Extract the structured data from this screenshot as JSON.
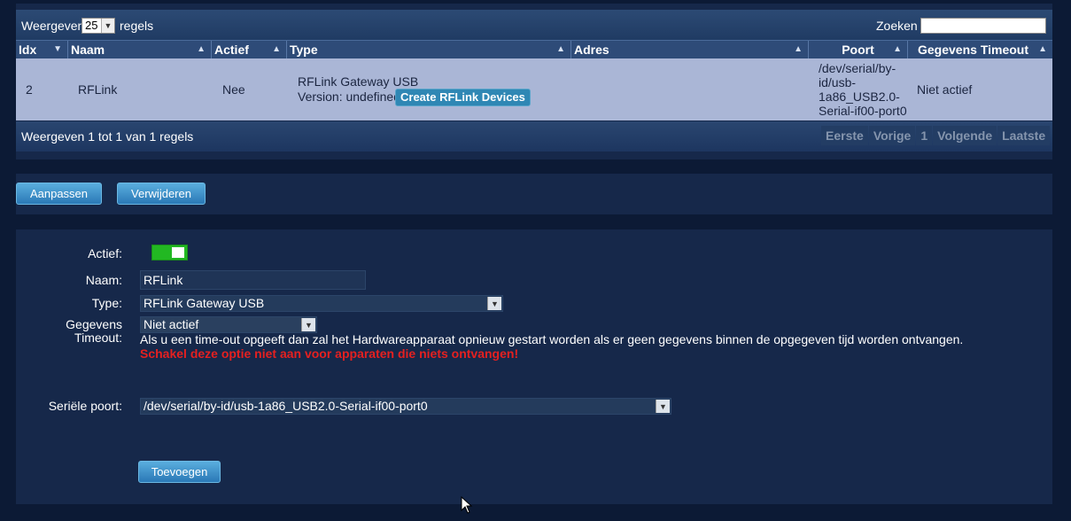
{
  "table": {
    "show_prefix": "Weergeven",
    "page_length": "25",
    "show_suffix": "regels",
    "search_label": "Zoeken :",
    "search_value": "",
    "columns": [
      "Idx",
      "Naam",
      "Actief",
      "Type",
      "Adres",
      "Poort",
      "Gegevens Timeout"
    ],
    "row": {
      "idx": "2",
      "naam": "RFLink",
      "actief": "Nee",
      "type_line1": "RFLink Gateway USB",
      "type_line2": "Version: undefined",
      "create_button": "Create RFLink Devices",
      "adres": "",
      "poort_lines": [
        "/dev/serial/by-",
        "id/usb-",
        "1a86_USB2.0-",
        "Serial-if00-port0"
      ],
      "timeout": "Niet actief"
    },
    "info": "Weergeven 1 tot 1 van 1 regels",
    "pager": [
      "Eerste",
      "Vorige",
      "1",
      "Volgende",
      "Laatste"
    ]
  },
  "actions": {
    "edit": "Aanpassen",
    "delete": "Verwijderen"
  },
  "form": {
    "active_label": "Actief:",
    "active_value": true,
    "name_label": "Naam:",
    "name_value": "RFLink",
    "type_label": "Type:",
    "type_value": "RFLink Gateway USB",
    "timeout_label_1": "Gegevens",
    "timeout_label_2": "Timeout:",
    "timeout_value": "Niet actief",
    "timeout_desc": "Als u een time-out opgeeft dan zal het Hardwareapparaat opnieuw gestart worden als er geen gegevens binnen de opgegeven tijd worden ontvangen.",
    "timeout_warning": "Schakel deze optie niet aan voor apparaten die niets ontvangen!",
    "serial_label": "Seriële poort:",
    "serial_value": "/dev/serial/by-id/usb-1a86_USB2.0-Serial-if00-port0",
    "add_button": "Toevoegen"
  },
  "colors": {
    "page_bg": "#0c1a35",
    "panel_bg": "#16284a",
    "row_bg": "#aab6d6",
    "toggle_on": "#22b822",
    "warning": "#e52020",
    "button": "#2a78b6"
  },
  "icons": {
    "sort": "sort-arrows-icon",
    "dropdown": "chevron-down-icon",
    "cursor": "mouse-pointer-icon"
  }
}
